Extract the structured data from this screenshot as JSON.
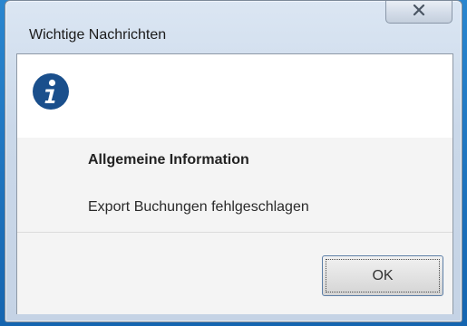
{
  "window": {
    "title": "Wichtige Nachrichten",
    "close_icon": "close-icon"
  },
  "dialog": {
    "icon": "info-icon",
    "heading": "Allgemeine Information",
    "message": "Export Buchungen fehlgeschlagen",
    "ok_label": "OK"
  },
  "colors": {
    "info_icon": "#1a4f8c",
    "desktop": "#1a6fb8"
  }
}
